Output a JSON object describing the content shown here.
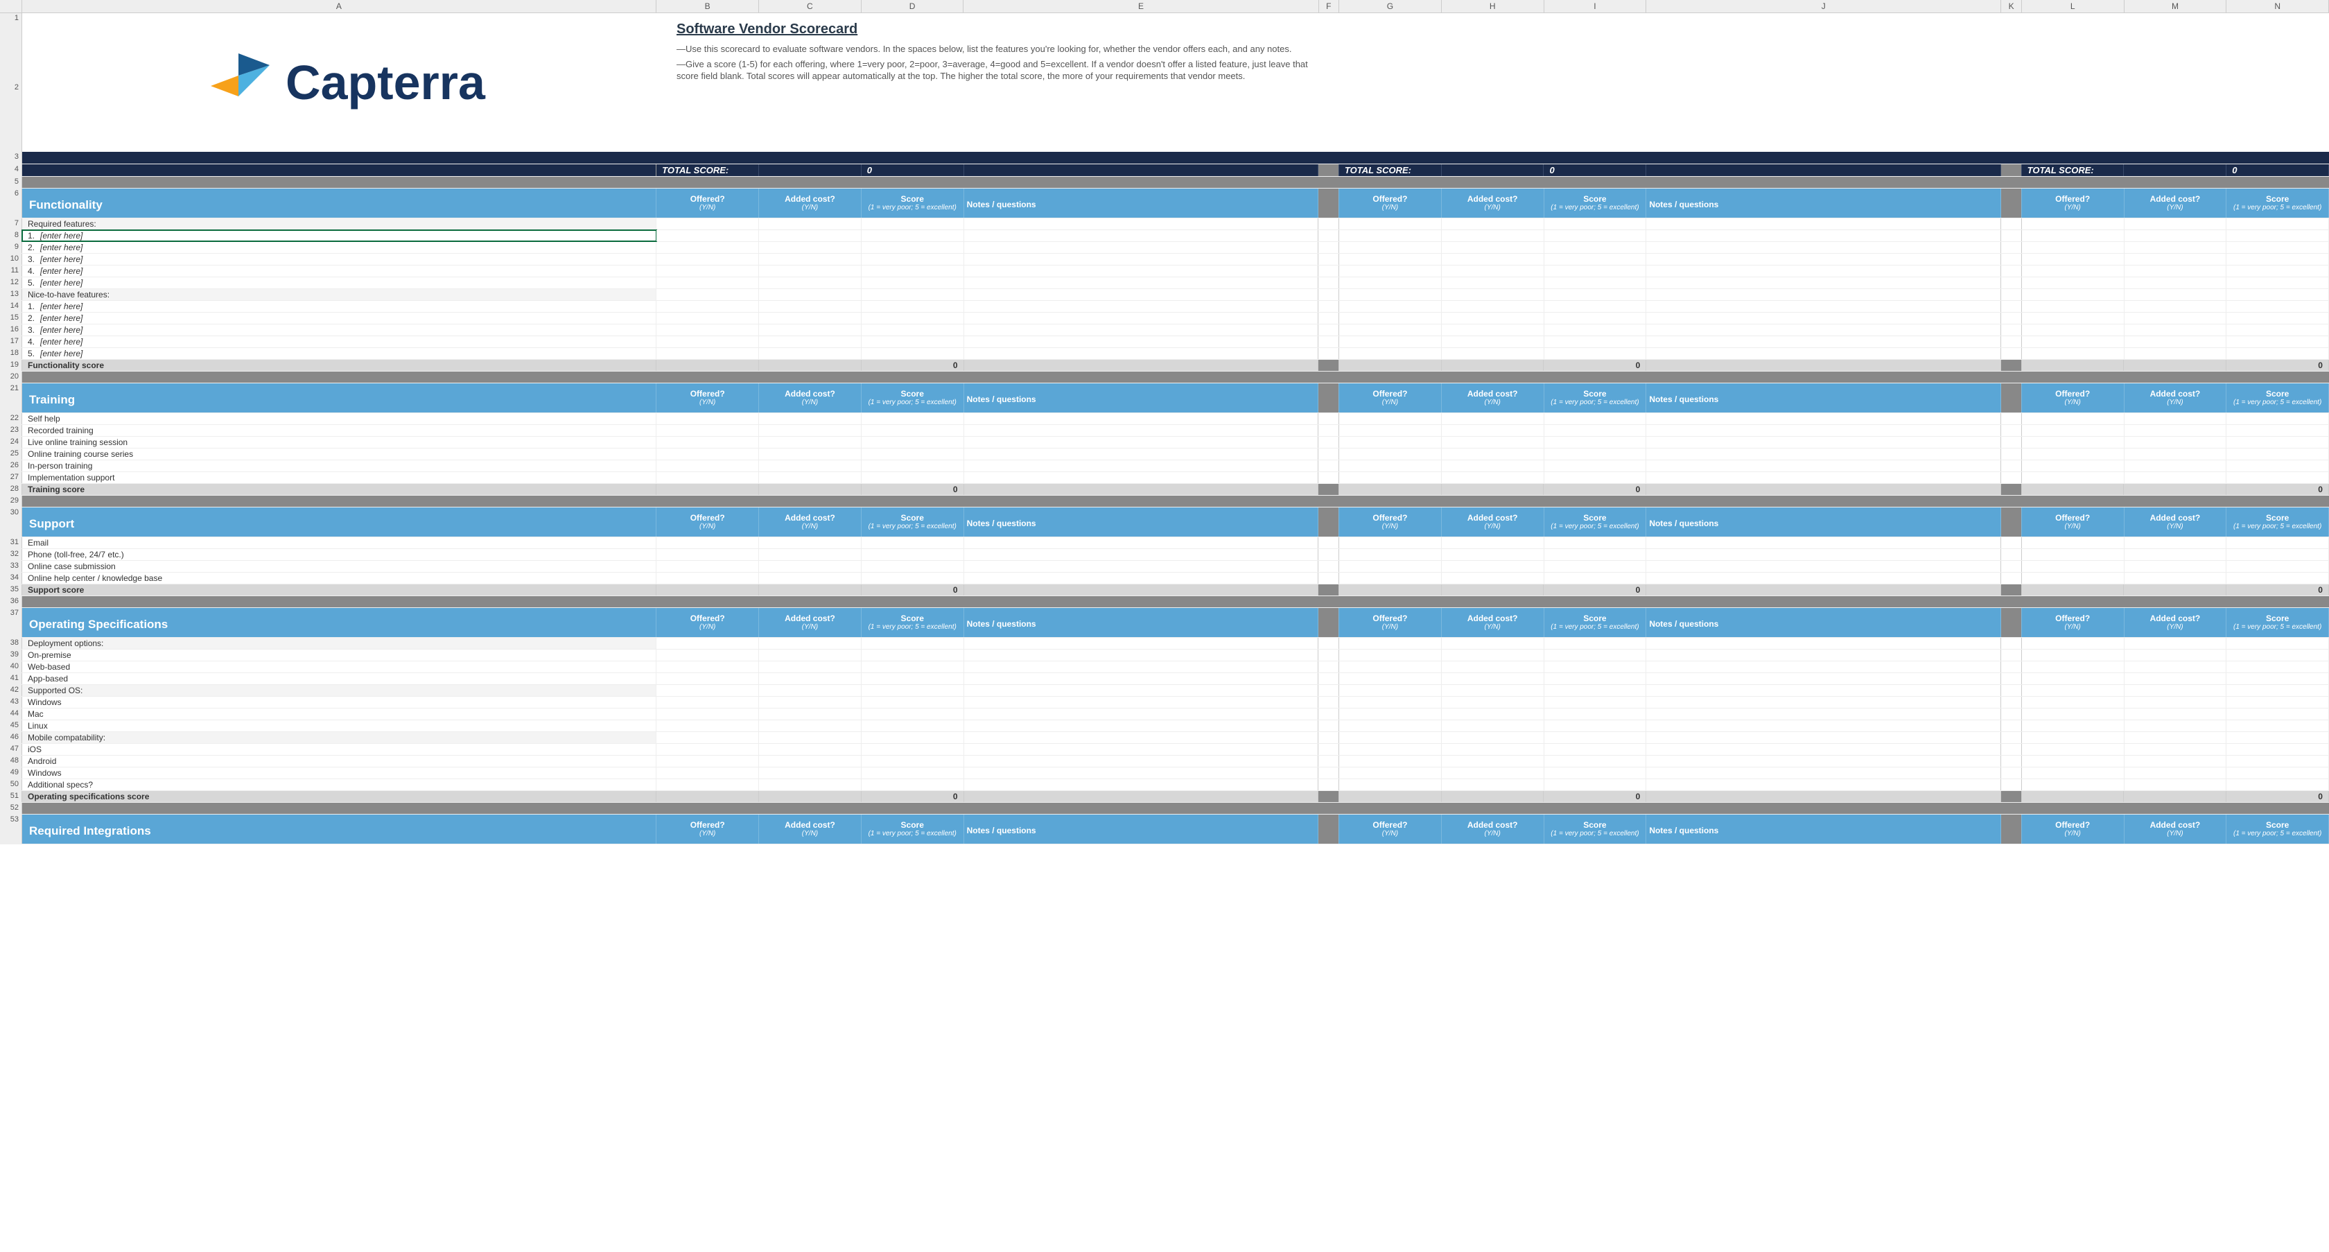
{
  "cols": [
    "A",
    "B",
    "C",
    "D",
    "E",
    "F",
    "G",
    "H",
    "I",
    "J",
    "K",
    "L",
    "M",
    "N"
  ],
  "logo_text": "Capterra",
  "title": "Software Vendor Scorecard",
  "instructions": [
    "—Use this scorecard to evaluate software vendors. In the spaces below, list the features you're looking for, whether the vendor offers each, and any notes.",
    "—Give a score (1-5) for each offering, where 1=very poor, 2=poor, 3=average, 4=good and 5=excellent. If a vendor doesn't offer a listed feature, just leave that score field blank. Total scores will appear automatically at the top. The higher the total score, the more of your requirements that vendor meets."
  ],
  "total_label": "TOTAL SCORE:",
  "total_value": "0",
  "hdr": {
    "offered": "Offered?",
    "offered_sub": "(Y/N)",
    "added": "Added cost?",
    "added_sub": "(Y/N)",
    "score": "Score",
    "score_sub": "(1 = very poor; 5 = excellent)",
    "notes": "Notes / questions"
  },
  "sections": [
    {
      "name": "Functionality",
      "score_label": "Functionality score",
      "score": "0",
      "rows": [
        {
          "t": "Required features:",
          "alt": true
        },
        {
          "t": "[enter here]",
          "n": "1.",
          "ital": true,
          "sel": true
        },
        {
          "t": "[enter here]",
          "n": "2.",
          "ital": true
        },
        {
          "t": "[enter here]",
          "n": "3.",
          "ital": true
        },
        {
          "t": "[enter here]",
          "n": "4.",
          "ital": true
        },
        {
          "t": "[enter here]",
          "n": "5.",
          "ital": true
        },
        {
          "t": "Nice-to-have features:",
          "alt": true
        },
        {
          "t": "[enter here]",
          "n": "1.",
          "ital": true
        },
        {
          "t": "[enter here]",
          "n": "2.",
          "ital": true
        },
        {
          "t": "[enter here]",
          "n": "3.",
          "ital": true
        },
        {
          "t": "[enter here]",
          "n": "4.",
          "ital": true
        },
        {
          "t": "[enter here]",
          "n": "5.",
          "ital": true
        }
      ]
    },
    {
      "name": "Training",
      "score_label": "Training score",
      "score": "0",
      "rows": [
        {
          "t": "Self help"
        },
        {
          "t": "Recorded training"
        },
        {
          "t": "Live online training session"
        },
        {
          "t": "Online training course series"
        },
        {
          "t": "In-person training"
        },
        {
          "t": "Implementation support"
        }
      ]
    },
    {
      "name": "Support",
      "score_label": "Support score",
      "score": "0",
      "support": true,
      "rows": [
        {
          "t": "Email"
        },
        {
          "t": "Phone (toll-free, 24/7 etc.)"
        },
        {
          "t": "Online case submission"
        },
        {
          "t": "Online help center / knowledge base"
        }
      ]
    },
    {
      "name": "Operating Specifications",
      "score_label": "Operating specifications score",
      "score": "0",
      "rows": [
        {
          "t": "Deployment options:",
          "alt": true
        },
        {
          "t": "On-premise"
        },
        {
          "t": "Web-based"
        },
        {
          "t": "App-based"
        },
        {
          "t": "Supported OS:",
          "alt": true
        },
        {
          "t": "Windows"
        },
        {
          "t": "Mac"
        },
        {
          "t": "Linux"
        },
        {
          "t": "Mobile compatability:",
          "alt": true
        },
        {
          "t": "iOS"
        },
        {
          "t": "Android"
        },
        {
          "t": "Windows"
        },
        {
          "t": "Additional specs?"
        }
      ]
    },
    {
      "name": "Required Integrations",
      "score_label": "",
      "score": "",
      "rows": []
    }
  ],
  "starting_rows": {
    "Functionality": 7,
    "Training": 22,
    "Support": 31,
    "Operating Specifications": 38,
    "Required Integrations": 54
  }
}
